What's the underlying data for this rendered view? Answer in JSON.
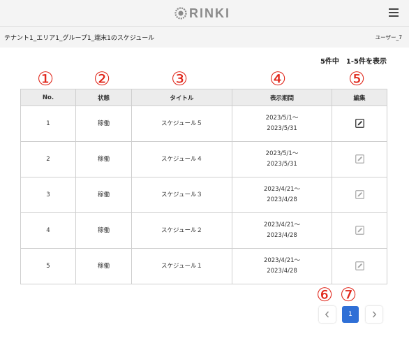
{
  "header": {
    "logo_text": "RINKI",
    "menu_icon": "hamburger-menu-icon"
  },
  "subbar": {
    "breadcrumb": "テナント1_エリア1_グループ1_端末1のスケジュール",
    "user": "ユーザー_7"
  },
  "summary": {
    "count_text": "5件中　1-5件を表示"
  },
  "markers": [
    "①",
    "②",
    "③",
    "④",
    "⑤",
    "⑥",
    "⑦"
  ],
  "table": {
    "headers": [
      "No.",
      "状態",
      "タイトル",
      "表示期間",
      "編集"
    ],
    "rows": [
      {
        "no": "1",
        "status": "稼働",
        "title": "スケジュール５",
        "period_start": "2023/5/1～",
        "period_end": "2023/5/31",
        "edit_enabled": true
      },
      {
        "no": "2",
        "status": "稼働",
        "title": "スケジュール４",
        "period_start": "2023/5/1～",
        "period_end": "2023/5/31",
        "edit_enabled": false
      },
      {
        "no": "3",
        "status": "稼働",
        "title": "スケジュール３",
        "period_start": "2023/4/21～",
        "period_end": "2023/4/28",
        "edit_enabled": false
      },
      {
        "no": "4",
        "status": "稼働",
        "title": "スケジュール２",
        "period_start": "2023/4/21～",
        "period_end": "2023/4/28",
        "edit_enabled": false
      },
      {
        "no": "5",
        "status": "稼働",
        "title": "スケジュール１",
        "period_start": "2023/4/21～",
        "period_end": "2023/4/28",
        "edit_enabled": false
      }
    ]
  },
  "pagination": {
    "current_page": "1",
    "prev_icon": "chevron-left-icon",
    "next_icon": "chevron-right-icon"
  },
  "colors": {
    "marker": "#e0261a",
    "accent": "#2f6fd6",
    "header_bg": "#f4f4f4"
  }
}
